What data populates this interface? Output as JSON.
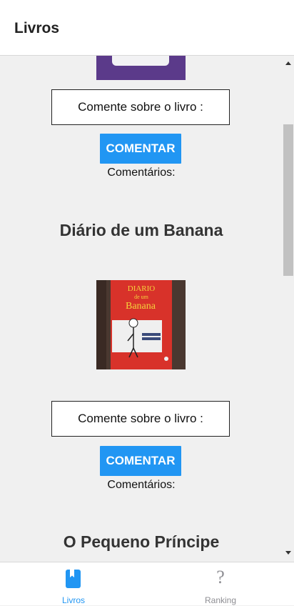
{
  "header": {
    "title": "Livros"
  },
  "books": [
    {
      "comment_prompt": "Comente sobre o livro :",
      "button_label": "COMENTAR",
      "comments_label": "Comentários:"
    },
    {
      "title": "Diário de um Banana",
      "comment_prompt": "Comente sobre o livro :",
      "button_label": "COMENTAR",
      "comments_label": "Comentários:",
      "cover_text": {
        "line1": "DIARIO",
        "line2": "de um",
        "line3": "Banana"
      }
    },
    {
      "title": "O Pequeno Príncipe"
    }
  ],
  "tabs": [
    {
      "label": "Livros",
      "icon": "book-icon",
      "active": true,
      "color": "#2196f3"
    },
    {
      "label": "Ranking",
      "icon": "question-icon",
      "active": false,
      "color": "#8e8e93"
    }
  ],
  "colors": {
    "accent": "#2196f3",
    "background": "#f0f0f0"
  }
}
